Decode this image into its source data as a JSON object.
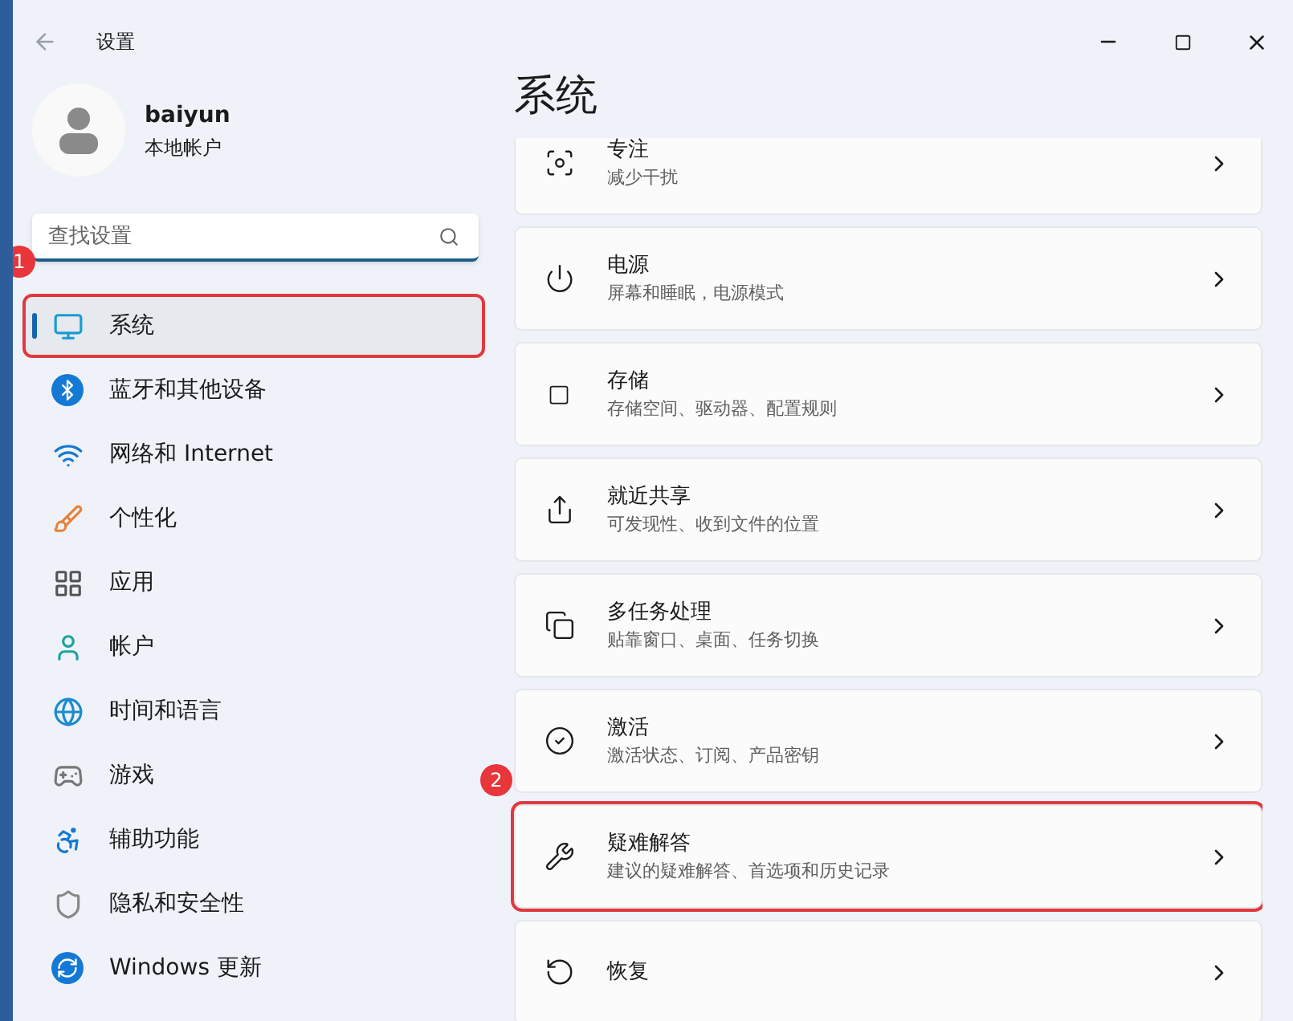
{
  "window": {
    "title": "设置"
  },
  "account": {
    "name": "baiyun",
    "type": "本地帐户"
  },
  "search": {
    "placeholder": "查找设置"
  },
  "sidebar": {
    "items": [
      {
        "label": "系统",
        "selected": true,
        "highlighted": true,
        "annotation": "1"
      },
      {
        "label": "蓝牙和其他设备",
        "selected": false
      },
      {
        "label": "网络和 Internet",
        "selected": false
      },
      {
        "label": "个性化",
        "selected": false
      },
      {
        "label": "应用",
        "selected": false
      },
      {
        "label": "帐户",
        "selected": false
      },
      {
        "label": "时间和语言",
        "selected": false
      },
      {
        "label": "游戏",
        "selected": false
      },
      {
        "label": "辅助功能",
        "selected": false
      },
      {
        "label": "隐私和安全性",
        "selected": false
      },
      {
        "label": "Windows 更新",
        "selected": false
      }
    ]
  },
  "page": {
    "title": "系统",
    "cards": [
      {
        "title": "专注",
        "subtitle": "减少干扰"
      },
      {
        "title": "电源",
        "subtitle": "屏幕和睡眠，电源模式"
      },
      {
        "title": "存储",
        "subtitle": "存储空间、驱动器、配置规则"
      },
      {
        "title": "就近共享",
        "subtitle": "可发现性、收到文件的位置"
      },
      {
        "title": "多任务处理",
        "subtitle": "贴靠窗口、桌面、任务切换"
      },
      {
        "title": "激活",
        "subtitle": "激活状态、订阅、产品密钥"
      },
      {
        "title": "疑难解答",
        "subtitle": "建议的疑难解答、首选项和历史记录",
        "highlighted": true,
        "annotation": "2"
      },
      {
        "title": "恢复"
      }
    ]
  }
}
